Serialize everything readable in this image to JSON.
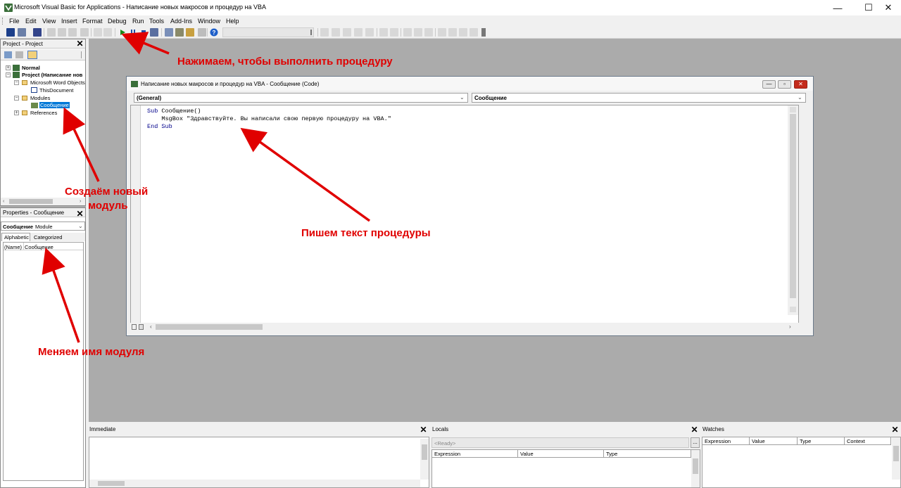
{
  "window": {
    "title": "Microsoft Visual Basic for Applications - Написание новых макросов и процедур на VBA",
    "controls": {
      "minimize": "—",
      "maximize": "☐",
      "close": "✕"
    }
  },
  "menu": [
    "File",
    "Edit",
    "View",
    "Insert",
    "Format",
    "Debug",
    "Run",
    "Tools",
    "Add-Ins",
    "Window",
    "Help"
  ],
  "toolbar": {
    "icons": [
      "view-word-icon",
      "insert-userform-icon",
      "save-icon",
      "cut-icon",
      "copy-icon",
      "paste-icon",
      "find-icon",
      "undo-icon",
      "redo-icon",
      "run-icon",
      "break-icon",
      "reset-icon",
      "design-mode-icon",
      "project-explorer-icon",
      "properties-icon",
      "object-browser-icon",
      "toolbox-icon",
      "help-icon"
    ],
    "accent_run": "#1a8a1a",
    "accent_help": "#1e5fc9"
  },
  "project": {
    "title": "Project - Project",
    "tree": {
      "normal": "Normal",
      "project": "Project (Написание нов",
      "word_objects": "Microsoft Word Objects",
      "this_document": "ThisDocument",
      "modules": "Modules",
      "module_selected": "Сообщение",
      "references": "References"
    }
  },
  "properties": {
    "title": "Properties - Сообщение",
    "object_name": "Сообщение",
    "object_type": "Module",
    "tabs": [
      "Alphabetic",
      "Categorized"
    ],
    "row_key": "(Name)",
    "row_value": "Сообщение"
  },
  "code_window": {
    "title": "Написание новых макросов и процедур на VBA - Сообщение (Code)",
    "object_combo": "(General)",
    "proc_combo": "Сообщение",
    "lines": [
      {
        "kw": "Sub",
        "rest": " Сообщение()"
      },
      {
        "kw": "",
        "rest": "    MsgBox \"Здравствуйте. Вы написали свою первую процедуру на VBA.\""
      },
      {
        "kw": "End Sub",
        "rest": ""
      }
    ]
  },
  "annotations": {
    "run": "Нажимаем, чтобы выполнить процедуру",
    "new_module_1": "Создаём новый",
    "new_module_2": "модуль",
    "write_code": "Пишем текст процедуры",
    "rename": "Меняем имя модуля",
    "color": "#e00000"
  },
  "immediate": {
    "title": "Immediate"
  },
  "locals": {
    "title": "Locals",
    "status": "<Ready>",
    "columns": [
      "Expression",
      "Value",
      "Type"
    ],
    "ellipsis": "..."
  },
  "watches": {
    "title": "Watches",
    "columns": [
      "Expression",
      "Value",
      "Type",
      "Context"
    ]
  }
}
